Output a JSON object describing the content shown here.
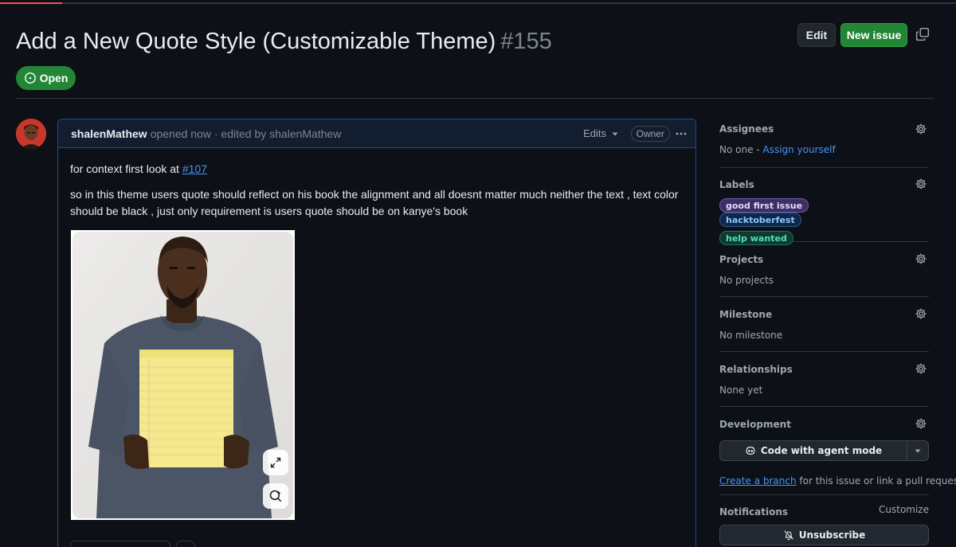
{
  "issue": {
    "title": "Add a New Quote Style (Customizable Theme)",
    "number": "#155",
    "state": "Open"
  },
  "header_buttons": {
    "edit": "Edit",
    "new_issue": "New issue"
  },
  "comment": {
    "author": "shalenMathew",
    "meta": "opened now · edited by shalenMathew",
    "edits": "Edits",
    "role": "Owner",
    "context_prefix": "for context first look at ",
    "context_link": "#107",
    "body": "so in this theme users quote should reflect on his book the alignment and all doesnt matter much neither the text , text color should be black , just only requirement is users quote should be on kanye's book"
  },
  "sidebar": {
    "assignees": {
      "heading": "Assignees",
      "text": "No one - ",
      "link": "Assign yourself"
    },
    "labels": {
      "heading": "Labels",
      "items": [
        "good first issue",
        "hacktoberfest",
        "help wanted"
      ]
    },
    "projects": {
      "heading": "Projects",
      "text": "No projects"
    },
    "milestone": {
      "heading": "Milestone",
      "text": "No milestone"
    },
    "relationships": {
      "heading": "Relationships",
      "text": "None yet"
    },
    "development": {
      "heading": "Development",
      "button": "Code with agent mode",
      "link": "Create a branch",
      "rest": " for this issue or link a pull request."
    },
    "notifications": {
      "heading": "Notifications",
      "customize": "Customize",
      "button": "Unsubscribe"
    }
  },
  "colors": {
    "background": "#0d1117",
    "accent_green": "#238636",
    "link_blue": "#4493f8",
    "comment_border": "#1f4b87"
  },
  "icons": [
    "copy-icon",
    "issue-open-icon",
    "triangle-down-icon",
    "kebab-horizontal-icon",
    "expand-icon",
    "zoom-icon",
    "gear-icon",
    "copilot-icon",
    "bell-slash-icon"
  ]
}
